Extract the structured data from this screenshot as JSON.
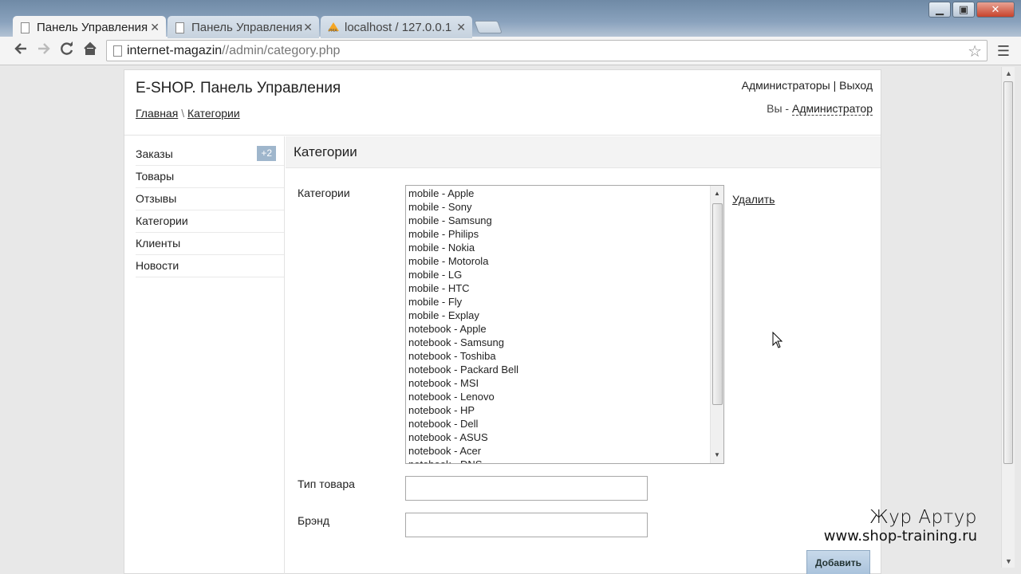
{
  "browser": {
    "tabs": [
      {
        "title": "Панель Управления",
        "active": true
      },
      {
        "title": "Панель Управления",
        "active": false
      },
      {
        "title": "localhost / 127.0.0.1",
        "active": false
      }
    ],
    "url_host": "internet-magazin",
    "url_path": "//admin/category.php",
    "icons": {
      "back": "back-arrow-icon",
      "forward": "forward-arrow-icon",
      "reload": "reload-icon",
      "home": "home-icon",
      "bookmark": "star-icon",
      "menu": "menu-icon"
    }
  },
  "header": {
    "brand": "E-SHOP. Панель Управления",
    "breadcrumb_home": "Главная",
    "breadcrumb_sep": "\\",
    "breadcrumb_current": "Категории",
    "top_admins": "Администраторы",
    "top_sep": "|",
    "top_logout": "Выход",
    "you_label": "Вы -",
    "you_role": "Администратор"
  },
  "sidebar": {
    "items": [
      {
        "label": "Заказы",
        "badge": "+2"
      },
      {
        "label": "Товары"
      },
      {
        "label": "Отзывы"
      },
      {
        "label": "Категории"
      },
      {
        "label": "Клиенты"
      },
      {
        "label": "Новости"
      }
    ]
  },
  "content": {
    "title": "Категории",
    "categories_label": "Категории",
    "categories": [
      "mobile - Apple",
      "mobile - Sony",
      "mobile - Samsung",
      "mobile - Philips",
      "mobile - Nokia",
      "mobile - Motorola",
      "mobile - LG",
      "mobile - HTC",
      "mobile - Fly",
      "mobile - Explay",
      "notebook - Apple",
      "notebook - Samsung",
      "notebook - Toshiba",
      "notebook - Packard Bell",
      "notebook - MSI",
      "notebook - Lenovo",
      "notebook - HP",
      "notebook - Dell",
      "notebook - ASUS",
      "notebook - Acer",
      "notebook - DNS"
    ],
    "delete_label": "Удалить",
    "type_label": "Тип товара",
    "type_value": "",
    "brand_label": "Брэнд",
    "brand_value": "",
    "add_label": "Добавить"
  },
  "watermark": {
    "name": "Жур Артур",
    "site": "www.shop-training.ru"
  }
}
